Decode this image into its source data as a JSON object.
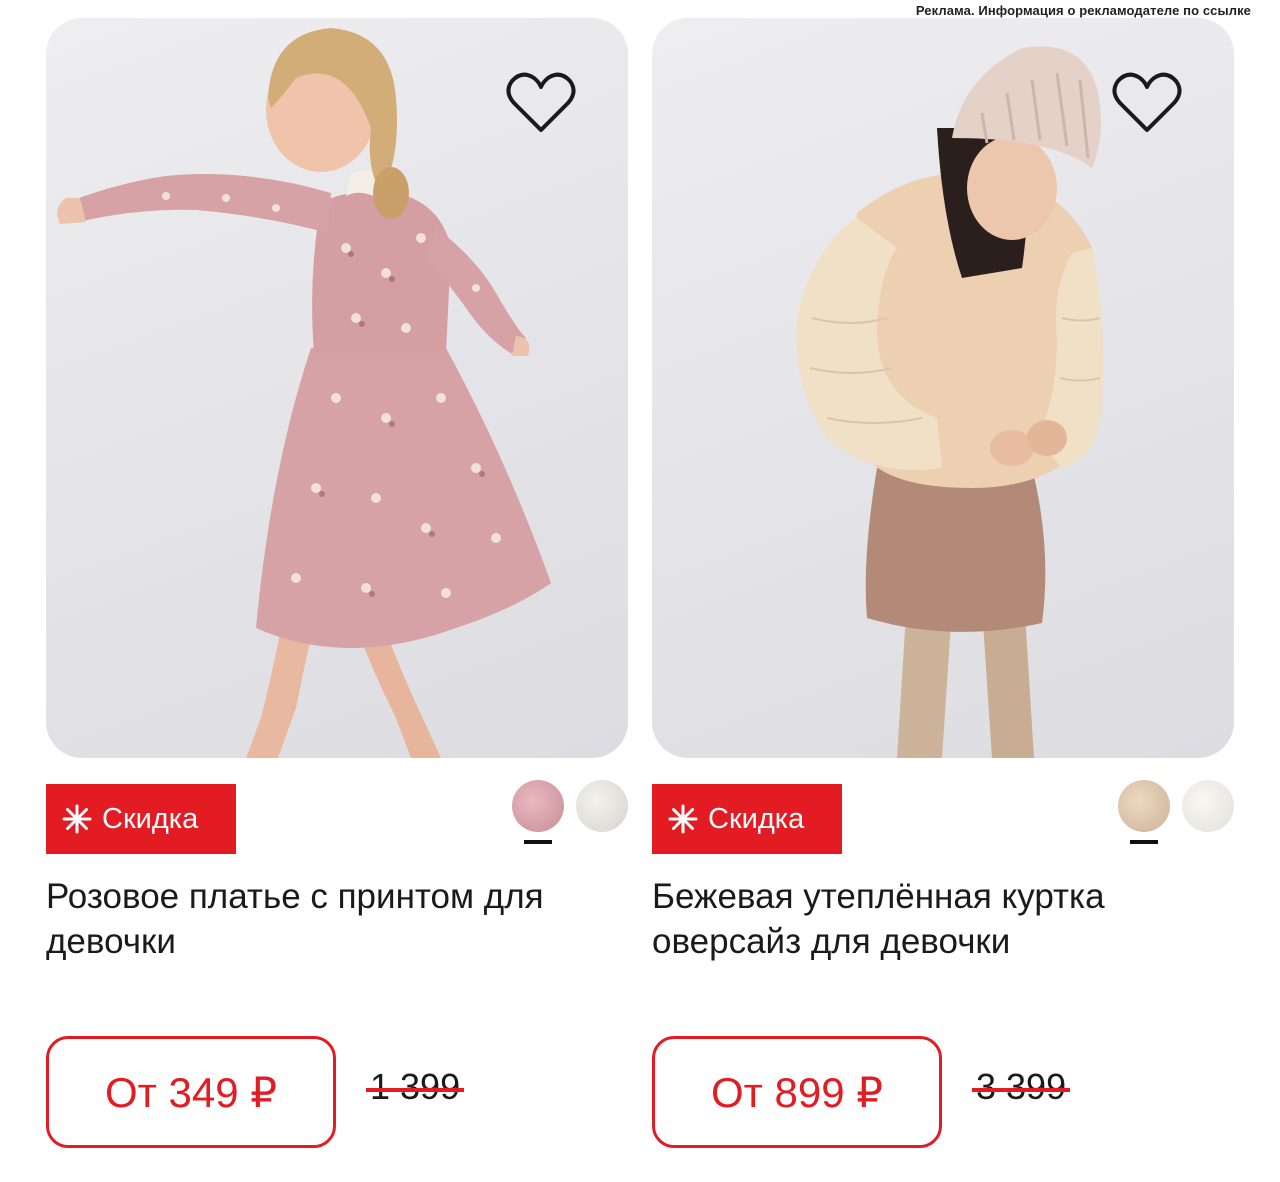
{
  "ad_notice": "Реклама. Информация о рекламодателе по ссылке",
  "colors": {
    "accent": "#e31b23",
    "text": "#1a1a1a",
    "photo_bg": "#e6e6ea"
  },
  "products": [
    {
      "badge": "Скидка",
      "badge_icon": "burst-icon",
      "favorite_icon": "heart-outline-icon",
      "title": "Розовое платье с принтом для девочки",
      "price": "От 349 ₽",
      "old_price": "1 399",
      "swatches": [
        {
          "color": "#d9a5ac",
          "selected": true
        },
        {
          "color": "#e9e7e3",
          "selected": false
        }
      ]
    },
    {
      "badge": "Скидка",
      "badge_icon": "burst-icon",
      "favorite_icon": "heart-outline-icon",
      "title": "Бежевая утеплённая куртка оверсайз для девочки",
      "price": "От 899 ₽",
      "old_price": "3 399",
      "swatches": [
        {
          "color": "#e2cbb2",
          "selected": true
        },
        {
          "color": "#f2f1ec",
          "selected": false
        }
      ]
    }
  ]
}
